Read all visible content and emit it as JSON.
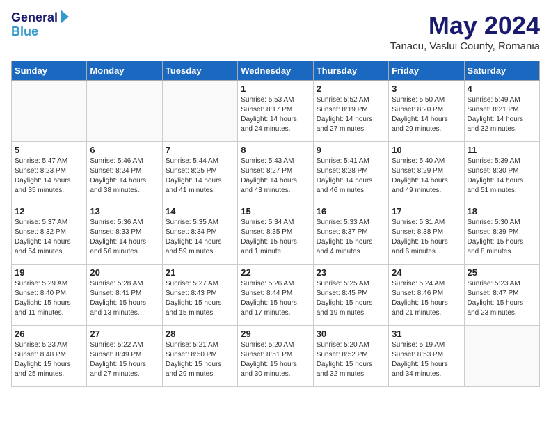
{
  "logo": {
    "line1": "General",
    "line2": "Blue"
  },
  "title": "May 2024",
  "location": "Tanacu, Vaslui County, Romania",
  "days_of_week": [
    "Sunday",
    "Monday",
    "Tuesday",
    "Wednesday",
    "Thursday",
    "Friday",
    "Saturday"
  ],
  "weeks": [
    [
      {
        "num": "",
        "info": ""
      },
      {
        "num": "",
        "info": ""
      },
      {
        "num": "",
        "info": ""
      },
      {
        "num": "1",
        "info": "Sunrise: 5:53 AM\nSunset: 8:17 PM\nDaylight: 14 hours\nand 24 minutes."
      },
      {
        "num": "2",
        "info": "Sunrise: 5:52 AM\nSunset: 8:19 PM\nDaylight: 14 hours\nand 27 minutes."
      },
      {
        "num": "3",
        "info": "Sunrise: 5:50 AM\nSunset: 8:20 PM\nDaylight: 14 hours\nand 29 minutes."
      },
      {
        "num": "4",
        "info": "Sunrise: 5:49 AM\nSunset: 8:21 PM\nDaylight: 14 hours\nand 32 minutes."
      }
    ],
    [
      {
        "num": "5",
        "info": "Sunrise: 5:47 AM\nSunset: 8:23 PM\nDaylight: 14 hours\nand 35 minutes."
      },
      {
        "num": "6",
        "info": "Sunrise: 5:46 AM\nSunset: 8:24 PM\nDaylight: 14 hours\nand 38 minutes."
      },
      {
        "num": "7",
        "info": "Sunrise: 5:44 AM\nSunset: 8:25 PM\nDaylight: 14 hours\nand 41 minutes."
      },
      {
        "num": "8",
        "info": "Sunrise: 5:43 AM\nSunset: 8:27 PM\nDaylight: 14 hours\nand 43 minutes."
      },
      {
        "num": "9",
        "info": "Sunrise: 5:41 AM\nSunset: 8:28 PM\nDaylight: 14 hours\nand 46 minutes."
      },
      {
        "num": "10",
        "info": "Sunrise: 5:40 AM\nSunset: 8:29 PM\nDaylight: 14 hours\nand 49 minutes."
      },
      {
        "num": "11",
        "info": "Sunrise: 5:39 AM\nSunset: 8:30 PM\nDaylight: 14 hours\nand 51 minutes."
      }
    ],
    [
      {
        "num": "12",
        "info": "Sunrise: 5:37 AM\nSunset: 8:32 PM\nDaylight: 14 hours\nand 54 minutes."
      },
      {
        "num": "13",
        "info": "Sunrise: 5:36 AM\nSunset: 8:33 PM\nDaylight: 14 hours\nand 56 minutes."
      },
      {
        "num": "14",
        "info": "Sunrise: 5:35 AM\nSunset: 8:34 PM\nDaylight: 14 hours\nand 59 minutes."
      },
      {
        "num": "15",
        "info": "Sunrise: 5:34 AM\nSunset: 8:35 PM\nDaylight: 15 hours\nand 1 minute."
      },
      {
        "num": "16",
        "info": "Sunrise: 5:33 AM\nSunset: 8:37 PM\nDaylight: 15 hours\nand 4 minutes."
      },
      {
        "num": "17",
        "info": "Sunrise: 5:31 AM\nSunset: 8:38 PM\nDaylight: 15 hours\nand 6 minutes."
      },
      {
        "num": "18",
        "info": "Sunrise: 5:30 AM\nSunset: 8:39 PM\nDaylight: 15 hours\nand 8 minutes."
      }
    ],
    [
      {
        "num": "19",
        "info": "Sunrise: 5:29 AM\nSunset: 8:40 PM\nDaylight: 15 hours\nand 11 minutes."
      },
      {
        "num": "20",
        "info": "Sunrise: 5:28 AM\nSunset: 8:41 PM\nDaylight: 15 hours\nand 13 minutes."
      },
      {
        "num": "21",
        "info": "Sunrise: 5:27 AM\nSunset: 8:43 PM\nDaylight: 15 hours\nand 15 minutes."
      },
      {
        "num": "22",
        "info": "Sunrise: 5:26 AM\nSunset: 8:44 PM\nDaylight: 15 hours\nand 17 minutes."
      },
      {
        "num": "23",
        "info": "Sunrise: 5:25 AM\nSunset: 8:45 PM\nDaylight: 15 hours\nand 19 minutes."
      },
      {
        "num": "24",
        "info": "Sunrise: 5:24 AM\nSunset: 8:46 PM\nDaylight: 15 hours\nand 21 minutes."
      },
      {
        "num": "25",
        "info": "Sunrise: 5:23 AM\nSunset: 8:47 PM\nDaylight: 15 hours\nand 23 minutes."
      }
    ],
    [
      {
        "num": "26",
        "info": "Sunrise: 5:23 AM\nSunset: 8:48 PM\nDaylight: 15 hours\nand 25 minutes."
      },
      {
        "num": "27",
        "info": "Sunrise: 5:22 AM\nSunset: 8:49 PM\nDaylight: 15 hours\nand 27 minutes."
      },
      {
        "num": "28",
        "info": "Sunrise: 5:21 AM\nSunset: 8:50 PM\nDaylight: 15 hours\nand 29 minutes."
      },
      {
        "num": "29",
        "info": "Sunrise: 5:20 AM\nSunset: 8:51 PM\nDaylight: 15 hours\nand 30 minutes."
      },
      {
        "num": "30",
        "info": "Sunrise: 5:20 AM\nSunset: 8:52 PM\nDaylight: 15 hours\nand 32 minutes."
      },
      {
        "num": "31",
        "info": "Sunrise: 5:19 AM\nSunset: 8:53 PM\nDaylight: 15 hours\nand 34 minutes."
      },
      {
        "num": "",
        "info": ""
      }
    ]
  ]
}
